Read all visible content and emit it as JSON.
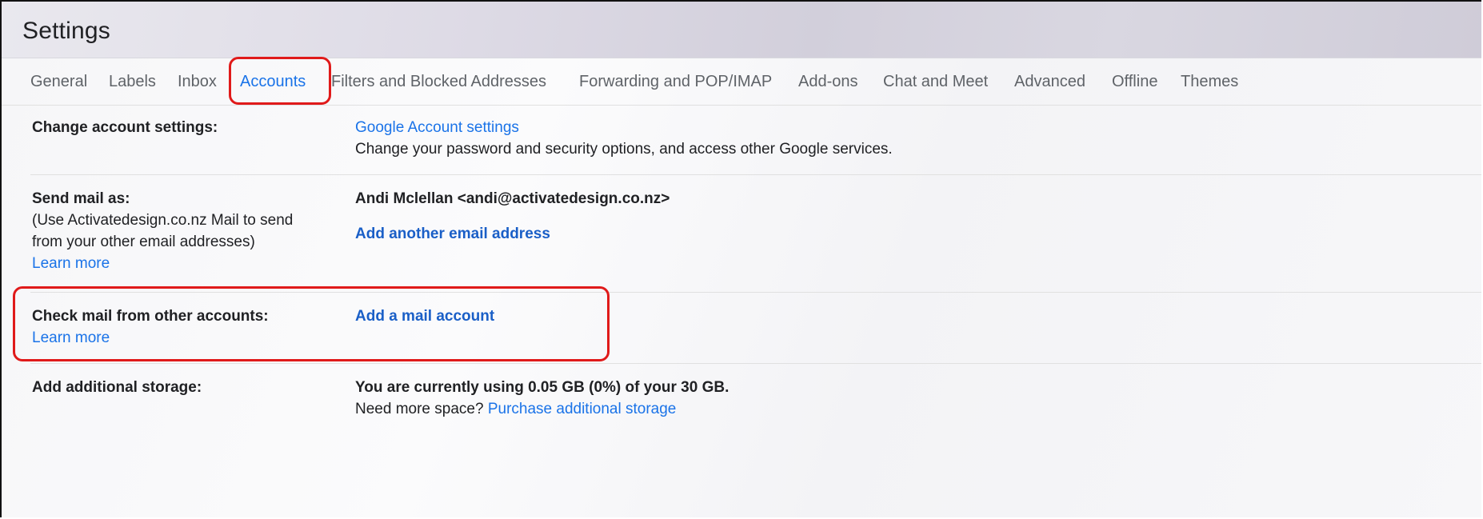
{
  "header": {
    "title": "Settings"
  },
  "tabs": [
    {
      "label": "General"
    },
    {
      "label": "Labels"
    },
    {
      "label": "Inbox"
    },
    {
      "label": "Accounts"
    },
    {
      "label": "Filters and Blocked Addresses"
    },
    {
      "label": "Forwarding and POP/IMAP"
    },
    {
      "label": "Add-ons"
    },
    {
      "label": "Chat and Meet"
    },
    {
      "label": "Advanced"
    },
    {
      "label": "Offline"
    },
    {
      "label": "Themes"
    }
  ],
  "active_tab": "Accounts",
  "sections": {
    "change_account": {
      "label": "Change account settings:",
      "link": "Google Account settings",
      "description": "Change your password and security options, and access other Google services."
    },
    "send_mail_as": {
      "label": "Send mail as:",
      "sub_line1": "(Use Activatedesign.co.nz Mail to send",
      "sub_line2": "from your other email addresses)",
      "learn_more": "Learn more",
      "address": "Andi Mclellan <andi@activatedesign.co.nz>",
      "add_link": "Add another email address"
    },
    "check_mail": {
      "label": "Check mail from other accounts:",
      "learn_more": "Learn more",
      "add_link": "Add a mail account"
    },
    "storage": {
      "label": "Add additional storage:",
      "usage": "You are currently using 0.05 GB (0%) of your 30 GB.",
      "need_more": "Need more space?",
      "purchase_link": "Purchase additional storage"
    }
  },
  "colors": {
    "accent": "#1a73e8",
    "highlight": "#e01a1a",
    "text": "#202124",
    "muted": "#5f6368"
  }
}
